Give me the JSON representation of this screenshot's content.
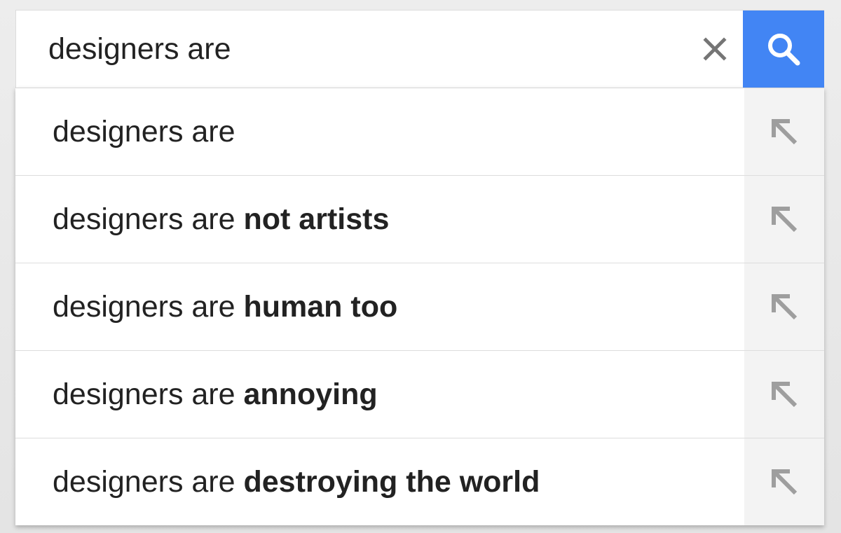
{
  "search": {
    "query": "designers are",
    "clear_icon": "close-icon",
    "search_icon": "search-icon",
    "accent_color": "#4285f4"
  },
  "suggestions": [
    {
      "base": "designers are",
      "completion": ""
    },
    {
      "base": "designers are ",
      "completion": "not artists"
    },
    {
      "base": "designers are ",
      "completion": "human too"
    },
    {
      "base": "designers are ",
      "completion": "annoying"
    },
    {
      "base": "designers are ",
      "completion": "destroying the world"
    }
  ],
  "suggestion_icon": "arrow-up-left-icon"
}
